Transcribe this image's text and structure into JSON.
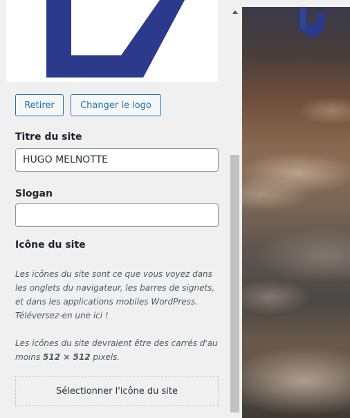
{
  "logo_controls": {
    "remove_label": "Retirer",
    "change_label": "Changer le logo"
  },
  "site_title": {
    "label": "Titre du site",
    "value": "HUGO MELNOTTE"
  },
  "tagline": {
    "label": "Slogan",
    "value": ""
  },
  "site_icon": {
    "label": "Icône du site",
    "description_1": "Les icônes du site sont ce que vous voyez dans les onglets du navigateur, les barres de signets, et dans les applications mobiles WordPress. Téléversez-en une ici !",
    "description_2_prefix": "Les icônes du site devraient être des carrés d'au moins ",
    "description_2_size": "512 × 512",
    "description_2_suffix": " pixels.",
    "select_label": "Sélectionner l'icône du site"
  },
  "colors": {
    "accent": "#2271b1",
    "logo_blue": "#2b3a8c"
  },
  "icons": {
    "scroll_up": "triangle-up-icon"
  }
}
